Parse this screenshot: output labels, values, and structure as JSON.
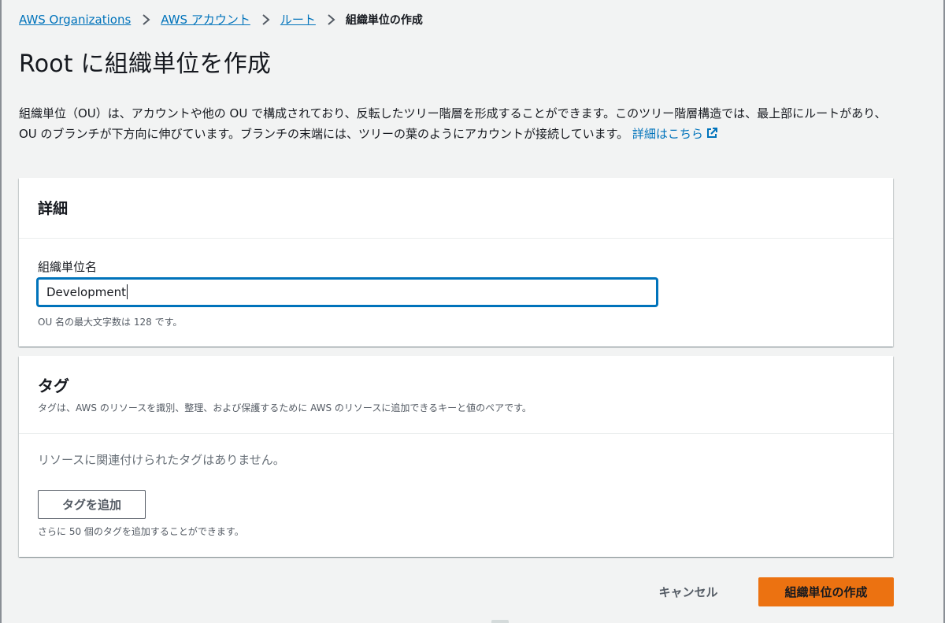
{
  "breadcrumb": {
    "items": [
      "AWS Organizations",
      "AWS アカウント",
      "ルート"
    ],
    "current": "組織単位の作成"
  },
  "page": {
    "title": "Root に組織単位を作成",
    "description": "組織単位（OU）は、アカウントや他の OU で構成されており、反転したツリー階層を形成することができます。このツリー階層構造では、最上部にルートがあり、OU のブランチが下方向に伸びています。ブランチの末端には、ツリーの葉のようにアカウントが接続しています。",
    "learn_more": "詳細はこちら"
  },
  "details": {
    "title": "詳細",
    "field_label": "組織単位名",
    "field_value": "Development",
    "constraint": "OU 名の最大文字数は 128 です。"
  },
  "tags": {
    "title": "タグ",
    "description": "タグは、AWS のリソースを識別、整理、および保護するために AWS のリソースに追加できるキーと値のペアです。",
    "empty_message": "リソースに関連付けられたタグはありません。",
    "add_button": "タグを追加",
    "remaining": "さらに 50 個のタグを追加することができます。"
  },
  "actions": {
    "cancel": "キャンセル",
    "submit": "組織単位の作成"
  },
  "colors": {
    "link": "#0073bb",
    "primary": "#ec7211",
    "background": "#f2f3f3",
    "text": "#16191f",
    "secondary_text": "#545b64"
  },
  "icons": {
    "breadcrumb_separator": "chevron-right-icon",
    "learn_more": "external-link-icon"
  }
}
